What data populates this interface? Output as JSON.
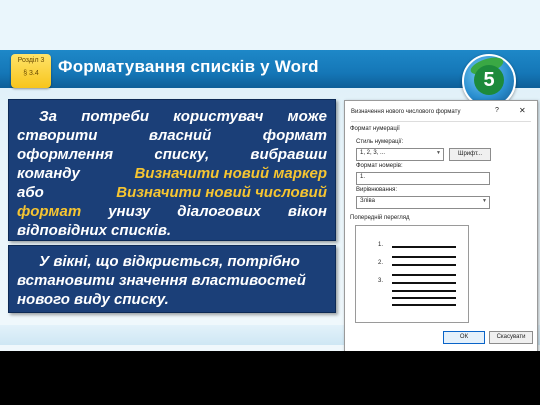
{
  "slide": {
    "title": "Форматування списків у Word",
    "section_badge": [
      "Розділ 3",
      "§ 3.4"
    ],
    "grade_number": "5"
  },
  "box1": {
    "lines": [
      [
        {
          "t": "За"
        },
        {
          "t": "потреби"
        },
        {
          "t": "користувач"
        },
        {
          "t": "може"
        }
      ],
      [
        {
          "t": "створити"
        },
        {
          "t": "власний"
        },
        {
          "t": "формат"
        }
      ],
      [
        {
          "t": "оформлення"
        },
        {
          "t": "списку,"
        },
        {
          "t": "вибравши"
        }
      ],
      [
        {
          "t": "команду"
        },
        {
          "t": "Визначити новий маркер",
          "hl": true
        }
      ],
      [
        {
          "t": "або"
        },
        {
          "t": "Визначити новий числовий",
          "hl": true
        }
      ],
      [
        {
          "t": "формат",
          "hl": true
        },
        {
          "t": "унизу"
        },
        {
          "t": "діалогових"
        },
        {
          "t": "вікон"
        }
      ],
      [
        {
          "t": "відповідних списків."
        }
      ]
    ]
  },
  "box2": {
    "lines": [
      [
        {
          "t": "У вікні, що відкриється, потрібно"
        }
      ],
      [
        {
          "t": "встановити значення властивостей"
        }
      ],
      [
        {
          "t": "нового виду списку."
        }
      ]
    ]
  },
  "dialog": {
    "title": "Визначення нового числового формату",
    "help": "?",
    "close": "✕",
    "group_numbering": "Формат нумерації",
    "style_label": "Стиль нумерації:",
    "style_value": "1, 2, 3, ...",
    "font_button": "Шрифт...",
    "format_label": "Формат номерів:",
    "format_value": "1.",
    "align_label": "Вирівнювання:",
    "align_value": "Зліва",
    "preview_label": "Попередній перегляд",
    "preview_numbers": [
      "1.",
      "2.",
      "3."
    ],
    "ok": "ОК",
    "cancel": "Скасувати"
  }
}
